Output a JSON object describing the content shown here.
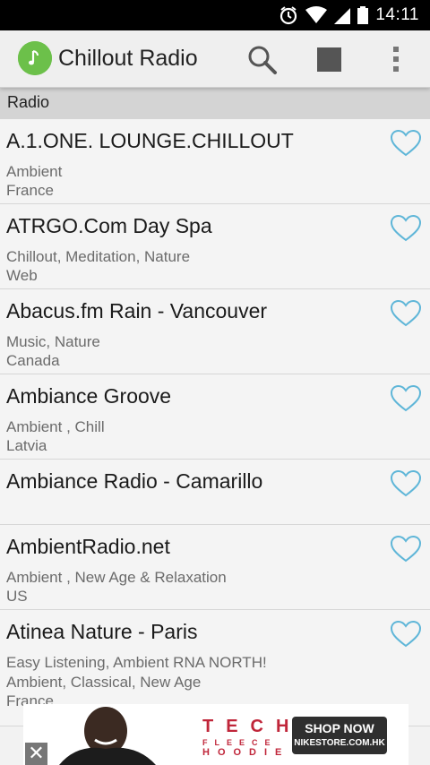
{
  "status_bar": {
    "time": "14:11",
    "icons": [
      "alarm-icon",
      "wifi-icon",
      "signal-icon",
      "battery-icon"
    ]
  },
  "action_bar": {
    "title": "Chillout Radio",
    "icons": [
      "app-logo-icon",
      "search-icon",
      "stop-icon",
      "overflow-menu-icon"
    ]
  },
  "section": {
    "label": "Radio"
  },
  "stations": [
    {
      "name": "A.1.ONE. LOUNGE.CHILLOUT",
      "genre": "Ambient",
      "country": "France"
    },
    {
      "name": "ATRGO.Com Day Spa",
      "genre": "Chillout, Meditation, Nature",
      "country": "Web"
    },
    {
      "name": "Abacus.fm Rain - Vancouver",
      "genre": "Music, Nature",
      "country": "Canada"
    },
    {
      "name": "Ambiance Groove",
      "genre": "Ambient , Chill",
      "country": "Latvia"
    },
    {
      "name": "Ambiance Radio - Camarillo",
      "genre": "",
      "country": ""
    },
    {
      "name": "AmbientRadio.net",
      "genre": "Ambient , New Age & Relaxation",
      "country": "US"
    },
    {
      "name": "Atinea Nature - Paris",
      "genre": "Easy Listening, Ambient RNA NORTH! Ambient, Classical, New Age",
      "country": "France"
    }
  ],
  "ad": {
    "headline": "TECH",
    "sub": "FLEECE",
    "product": "HOODIE",
    "cta_line1": "SHOP NOW",
    "cta_line2": "NIKESTORE.COM.HK",
    "close": "✕"
  },
  "colors": {
    "accent_heart": "#5fb6d8",
    "logo_green": "#6cc04a"
  }
}
